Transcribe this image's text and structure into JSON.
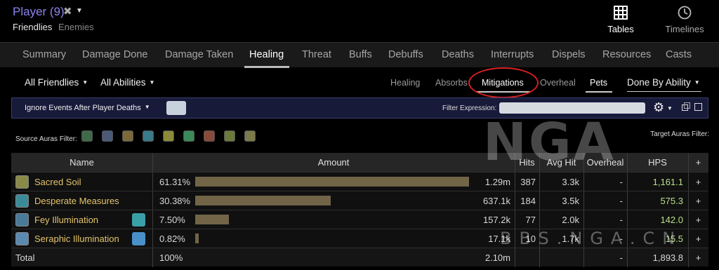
{
  "header": {
    "player_title": "Player (9)",
    "subtabs": [
      "Friendlies",
      "Enemies"
    ],
    "nav": [
      {
        "label": "Tables",
        "icon": "grid-icon"
      },
      {
        "label": "Timelines",
        "icon": "clock-icon"
      }
    ]
  },
  "tabs": [
    "Summary",
    "Damage Done",
    "Damage Taken",
    "Healing",
    "Threat",
    "Buffs",
    "Debuffs",
    "Deaths",
    "Interrupts",
    "Dispels",
    "Resources",
    "Casts"
  ],
  "active_tab": "Healing",
  "filters": {
    "friendlies": "All Friendlies",
    "abilities": "All Abilities",
    "modes": [
      "Healing",
      "Absorbs",
      "Mitigations",
      "Overheal",
      "Pets"
    ],
    "active_mode": "Mitigations",
    "done_by": "Done By Ability",
    "ignore_events": "Ignore Events After Player Deaths",
    "filter_expression_label": "Filter Expression:",
    "filter_expression_value": ""
  },
  "auras": {
    "source_label": "Source Auras Filter:",
    "target_label": "Target Auras Filter:",
    "source_icons": [
      "#3e6a4a",
      "#4a5a78",
      "#7a6a3a",
      "#3a7a8a",
      "#8a8a3a",
      "#3a8a5a",
      "#8a4a3a",
      "#6a7a3a",
      "#7a7a4a"
    ]
  },
  "table": {
    "columns": [
      "Name",
      "Amount",
      "Hits",
      "Avg Hit",
      "Overheal",
      "HPS",
      "+"
    ],
    "rows": [
      {
        "name": "Sacred Soil",
        "pct": "61.31%",
        "pct_value": 61.31,
        "amount": "1.29m",
        "hits": "387",
        "avg": "3.3k",
        "overheal": "-",
        "hps": "1,161.1",
        "plus": "+",
        "icon_color": "#8a8a48",
        "has_extra_icon": false
      },
      {
        "name": "Desperate Measures",
        "pct": "30.38%",
        "pct_value": 30.38,
        "amount": "637.1k",
        "hits": "184",
        "avg": "3.5k",
        "overheal": "-",
        "hps": "575.3",
        "plus": "+",
        "icon_color": "#3a8a9a",
        "has_extra_icon": false
      },
      {
        "name": "Fey Illumination",
        "pct": "7.50%",
        "pct_value": 7.5,
        "amount": "157.2k",
        "hits": "77",
        "avg": "2.0k",
        "overheal": "-",
        "hps": "142.0",
        "plus": "+",
        "icon_color": "#4a7a9a",
        "has_extra_icon": true,
        "extra_icon_color": "#3aa0a8"
      },
      {
        "name": "Seraphic Illumination",
        "pct": "0.82%",
        "pct_value": 0.82,
        "amount": "17.1k",
        "hits": "10",
        "avg": "1.7k",
        "overheal": "-",
        "hps": "15.5",
        "plus": "+",
        "icon_color": "#5a8ab0",
        "has_extra_icon": true,
        "extra_icon_color": "#4a90c8"
      }
    ],
    "total": {
      "label": "Total",
      "pct": "100%",
      "amount": "2.10m",
      "overheal": "-",
      "hps": "1,893.8",
      "plus": "+"
    }
  },
  "watermark": {
    "big": "NGA",
    "small": "BBS.NGA.CN"
  },
  "colors": {
    "accent": "#8c84f0",
    "bar": "#716447",
    "name": "#e4c46a",
    "hps": "#b8e08a",
    "highlight_circle": "#d82020"
  }
}
